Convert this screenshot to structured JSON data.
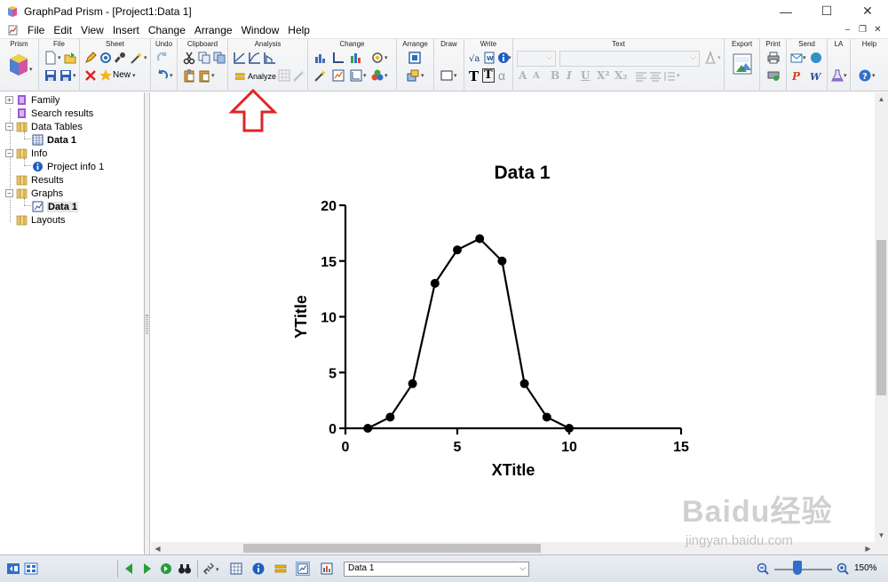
{
  "window": {
    "title": "GraphPad Prism - [Project1:Data 1]",
    "controls": {
      "minimize": "—",
      "maximize": "☐",
      "close": "✕"
    },
    "mdi_controls": [
      "–",
      "❐",
      "✕"
    ]
  },
  "menubar": {
    "items": [
      {
        "label": "File"
      },
      {
        "label": "Edit"
      },
      {
        "label": "View"
      },
      {
        "label": "Insert"
      },
      {
        "label": "Change"
      },
      {
        "label": "Arrange"
      },
      {
        "label": "Window"
      },
      {
        "label": "Help"
      }
    ]
  },
  "ribbon": {
    "groups": [
      "Prism",
      "File",
      "Sheet",
      "Undo",
      "Clipboard",
      "Analysis",
      "Change",
      "Arrange",
      "Draw",
      "Write",
      "Text",
      "Export",
      "Print",
      "Send",
      "LA",
      "Help"
    ],
    "analyze_label": "Analyze",
    "new_label": "New",
    "write_labels": {
      "T": "T",
      "alpha": "α"
    },
    "text_format_labels": [
      "A",
      "A",
      "B",
      "I",
      "U",
      "X²",
      "X₂"
    ]
  },
  "navigator": {
    "items": [
      {
        "label": "Family",
        "icon": "family-icon",
        "expander": "+",
        "level": 0
      },
      {
        "label": "Search results",
        "icon": "search-results-icon",
        "level": 0
      },
      {
        "label": "Data Tables",
        "icon": "folder-icon",
        "expander": "−",
        "level": 0
      },
      {
        "label": "Data 1",
        "icon": "data-table-icon",
        "level": 1,
        "bold": true
      },
      {
        "label": "Info",
        "icon": "folder-icon",
        "expander": "−",
        "level": 0
      },
      {
        "label": "Project info 1",
        "icon": "info-icon",
        "level": 1
      },
      {
        "label": "Results",
        "icon": "folder-icon",
        "level": 0
      },
      {
        "label": "Graphs",
        "icon": "folder-icon",
        "expander": "−",
        "level": 0
      },
      {
        "label": "Data 1",
        "icon": "graph-icon",
        "level": 1,
        "bold": true,
        "selected": true
      },
      {
        "label": "Layouts",
        "icon": "folder-icon",
        "level": 0
      }
    ]
  },
  "chart_data": {
    "type": "line",
    "title": "Data 1",
    "xlabel": "XTitle",
    "ylabel": "YTitle",
    "xlim": [
      0,
      15
    ],
    "ylim": [
      0,
      20
    ],
    "xticks": [
      0,
      5,
      10,
      15
    ],
    "yticks": [
      0,
      5,
      10,
      15,
      20
    ],
    "grid": false,
    "markers": "filled-circle",
    "series": [
      {
        "x": [
          1,
          2,
          3,
          4,
          5,
          6,
          7,
          8,
          9,
          10
        ],
        "y": [
          0,
          1,
          4,
          13,
          16,
          17,
          15,
          4,
          1,
          0
        ]
      }
    ],
    "line_color": "#000000"
  },
  "statusbar": {
    "sheet_selector_value": "Data 1",
    "zoom_level": "150%",
    "zoom_fraction": 0.4
  },
  "watermark": {
    "brand": "Baidu经验",
    "url": "jingyan.baidu.com"
  },
  "colors": {
    "annotation_arrow": "#e02424",
    "ribbon_bg": "#eef0f3",
    "status_bg": "#dde3eb",
    "zoom_thumb": "#2f6fc9"
  }
}
